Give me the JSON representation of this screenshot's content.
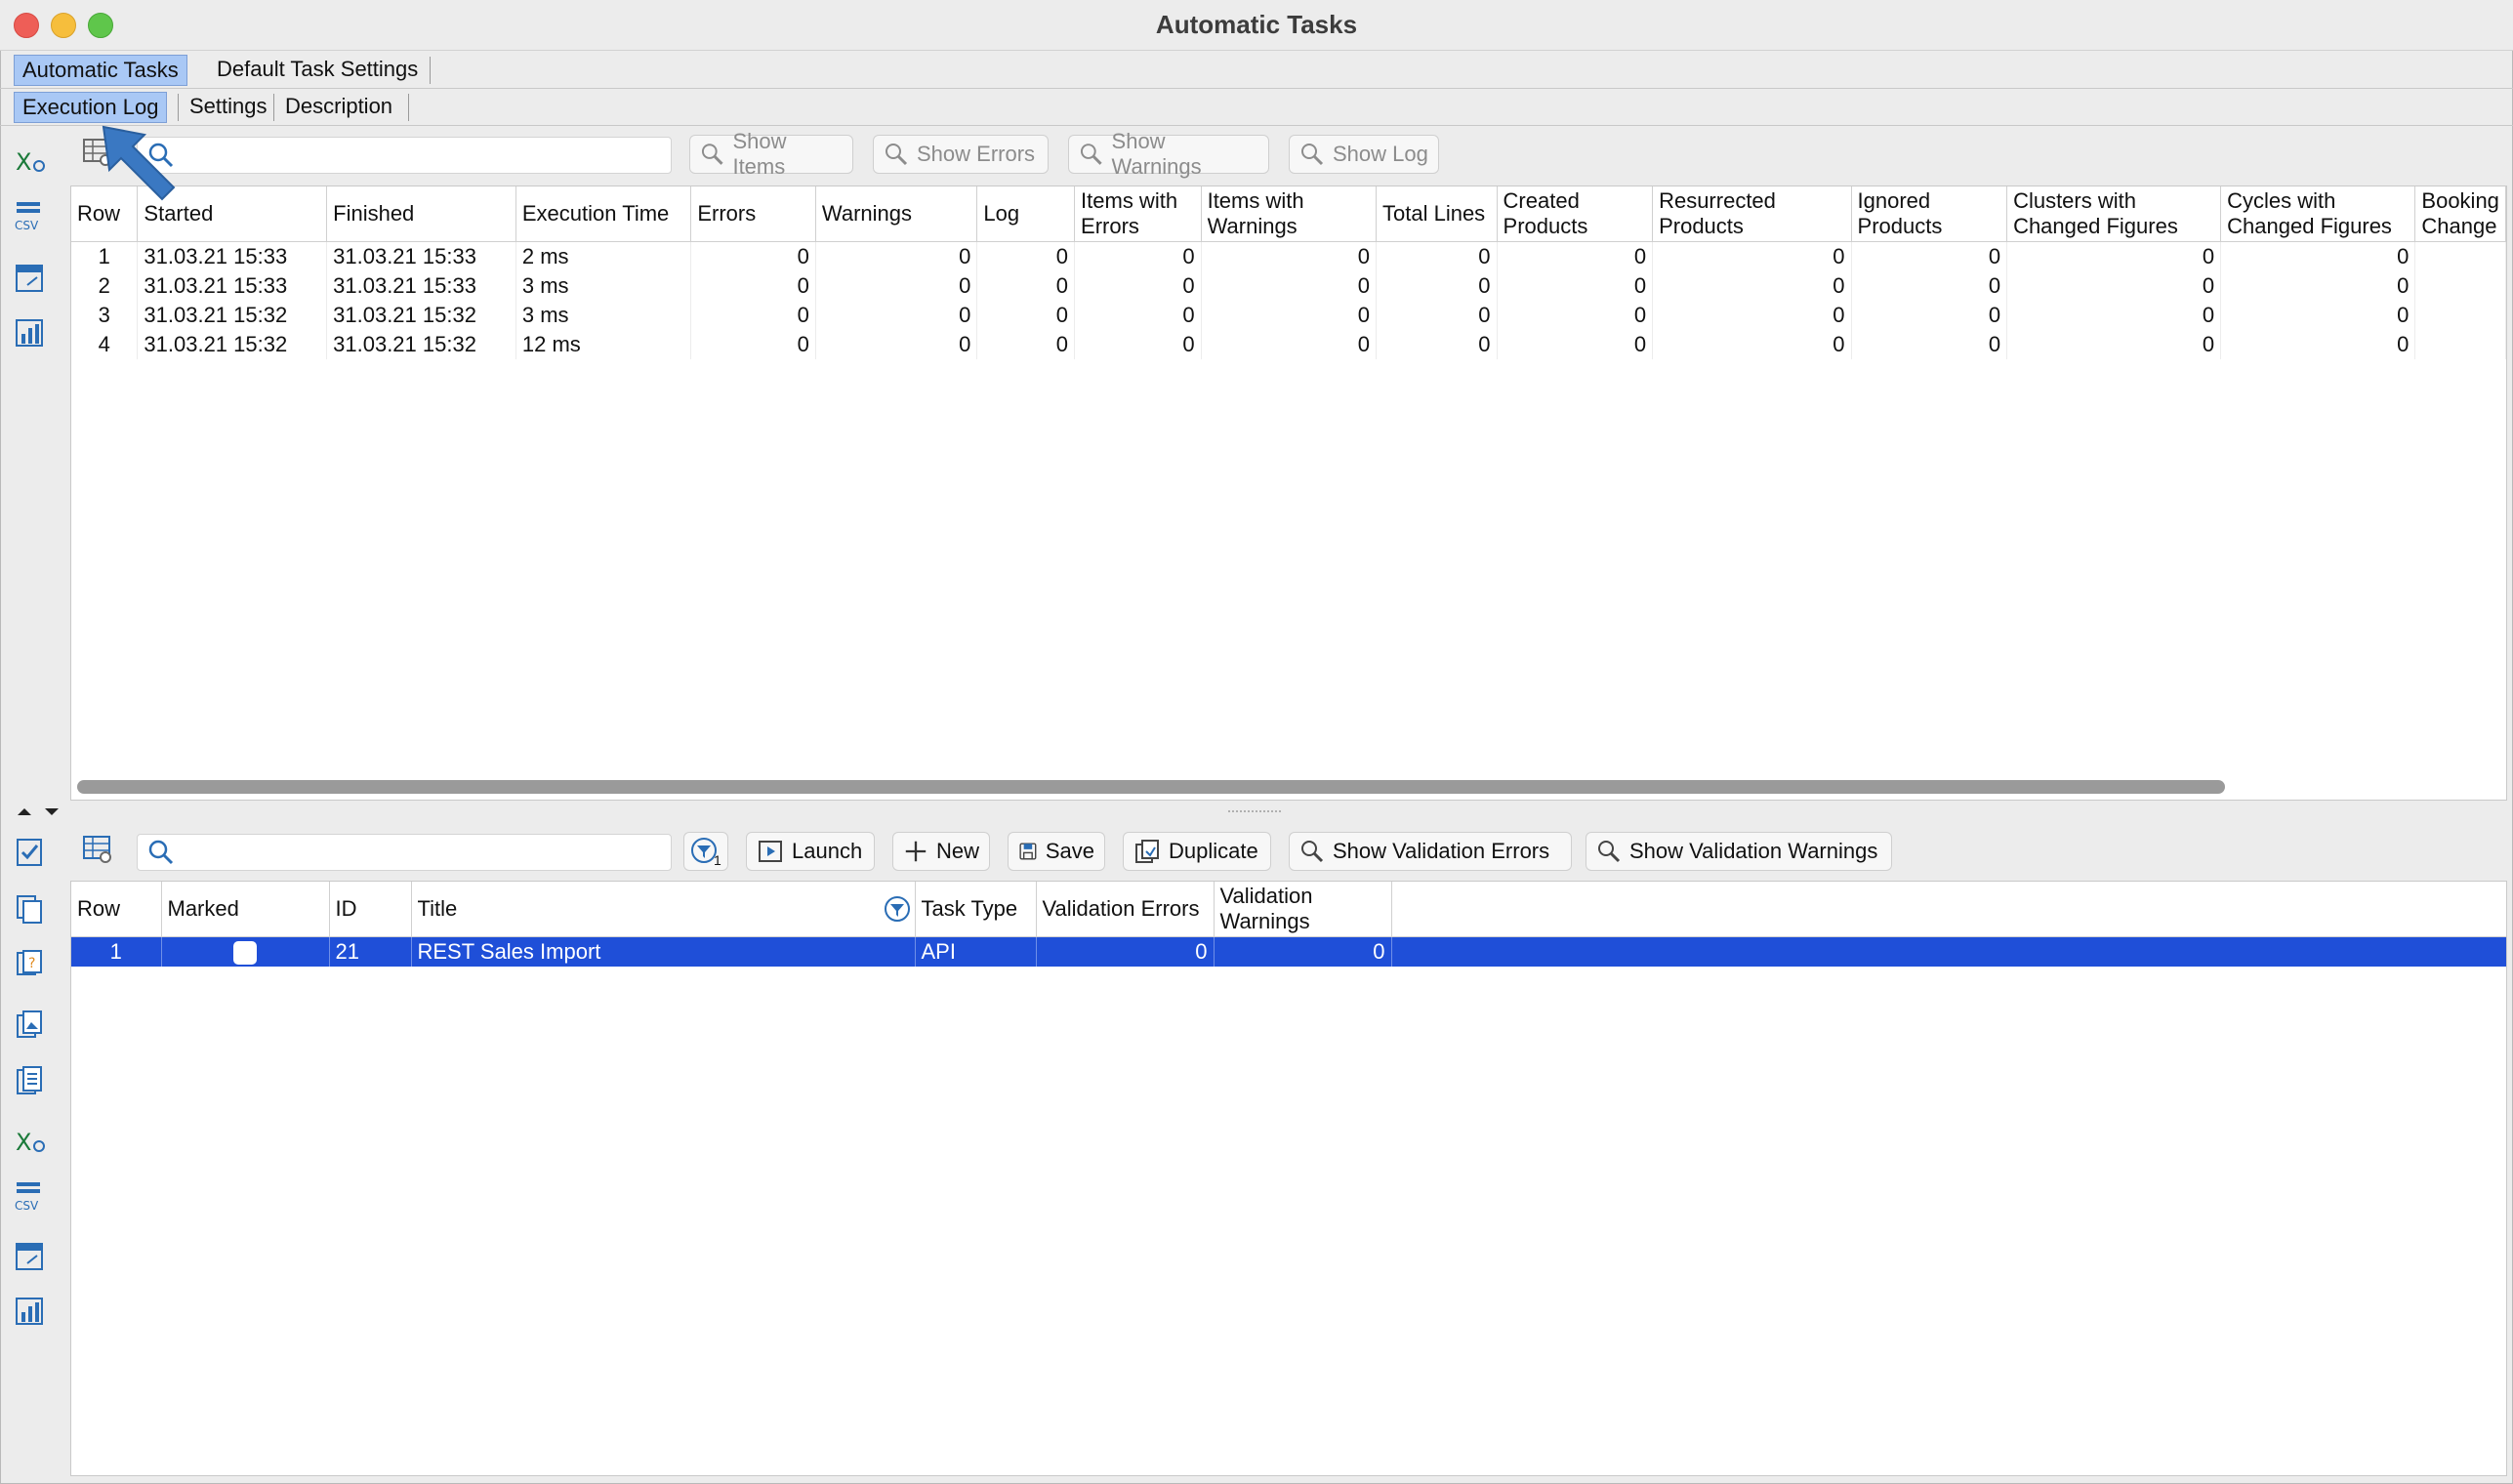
{
  "window": {
    "title": "Automatic Tasks"
  },
  "tabs": [
    "Automatic Tasks",
    "Default Task Settings"
  ],
  "subtabs": [
    "Execution Log",
    "Settings",
    "Description"
  ],
  "log_toolbar": {
    "search_value": "",
    "buttons": [
      "Show Items",
      "Show Errors",
      "Show Warnings",
      "Show Log"
    ]
  },
  "log_table": {
    "columns": [
      "Row",
      "Started",
      "Finished",
      "Execution Time",
      "Errors",
      "Warnings",
      "Log",
      "Items with Errors",
      "Items with Warnings",
      "Total Lines",
      "Created Products",
      "Resurrected Products",
      "Ignored Products",
      "Clusters with Changed Figures",
      "Cycles with Changed Figures",
      "Booking Change"
    ],
    "rows": [
      [
        "1",
        "31.03.21 15:33",
        "31.03.21 15:33",
        "2 ms",
        "0",
        "0",
        "0",
        "0",
        "0",
        "0",
        "0",
        "0",
        "0",
        "0",
        "0"
      ],
      [
        "2",
        "31.03.21 15:33",
        "31.03.21 15:33",
        "3 ms",
        "0",
        "0",
        "0",
        "0",
        "0",
        "0",
        "0",
        "0",
        "0",
        "0",
        "0"
      ],
      [
        "3",
        "31.03.21 15:32",
        "31.03.21 15:32",
        "3 ms",
        "0",
        "0",
        "0",
        "0",
        "0",
        "0",
        "0",
        "0",
        "0",
        "0",
        "0"
      ],
      [
        "4",
        "31.03.21 15:32",
        "31.03.21 15:32",
        "12 ms",
        "0",
        "0",
        "0",
        "0",
        "0",
        "0",
        "0",
        "0",
        "0",
        "0",
        "0"
      ]
    ]
  },
  "task_toolbar": {
    "search_value": "",
    "filter_badge": "1",
    "buttons": [
      "Launch",
      "New",
      "Save",
      "Duplicate",
      "Show Validation Errors",
      "Show Validation Warnings"
    ]
  },
  "task_table": {
    "columns": [
      "Row",
      "Marked",
      "ID",
      "Title",
      "Task Type",
      "Validation Errors",
      "Validation Warnings"
    ],
    "rows": [
      {
        "row": "1",
        "marked": false,
        "id": "21",
        "title": "REST Sales Import",
        "task_type": "API",
        "validation_errors": "0",
        "validation_warnings": "0"
      }
    ]
  },
  "colors": {
    "selection": "#1f4fd8",
    "tab_selected": "#a9c8f5",
    "pointer_arrow": "#3a78c2"
  },
  "icons": {
    "left_sidebar_top": [
      "excel-export-icon",
      "csv-export-icon",
      "table-export-icon",
      "chart-icon"
    ],
    "left_sidebar_bottom": [
      "checklist-icon",
      "copy-icon",
      "help-doc-icon",
      "image-export-icon",
      "list-doc-icon",
      "excel-export-icon",
      "csv-export-icon",
      "table-export-icon",
      "chart-icon"
    ]
  }
}
